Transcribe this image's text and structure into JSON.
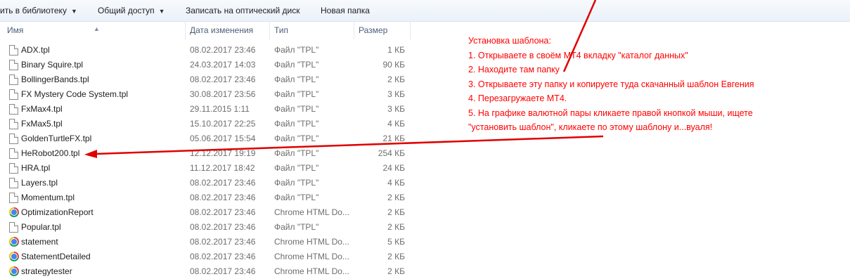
{
  "toolbar": {
    "items": [
      {
        "label": "ить в библиотеку",
        "has_dropdown": true
      },
      {
        "label": "Общий доступ",
        "has_dropdown": true
      },
      {
        "label": "Записать на оптический диск",
        "has_dropdown": false
      },
      {
        "label": "Новая папка",
        "has_dropdown": false
      }
    ]
  },
  "columns": {
    "name": "Имя",
    "date": "Дата изменения",
    "type": "Тип",
    "size": "Размер"
  },
  "files": [
    {
      "name": "ADX.tpl",
      "date": "08.02.2017 23:46",
      "type": "Файл \"TPL\"",
      "size": "1 КБ",
      "icon": "file-icon"
    },
    {
      "name": "Binary Squire.tpl",
      "date": "24.03.2017 14:03",
      "type": "Файл \"TPL\"",
      "size": "90 КБ",
      "icon": "file-icon"
    },
    {
      "name": "BollingerBands.tpl",
      "date": "08.02.2017 23:46",
      "type": "Файл \"TPL\"",
      "size": "2 КБ",
      "icon": "file-icon"
    },
    {
      "name": "FX Mystery Code System.tpl",
      "date": "30.08.2017 23:56",
      "type": "Файл \"TPL\"",
      "size": "3 КБ",
      "icon": "file-icon"
    },
    {
      "name": "FxMax4.tpl",
      "date": "29.11.2015 1:11",
      "type": "Файл \"TPL\"",
      "size": "3 КБ",
      "icon": "file-icon"
    },
    {
      "name": "FxMax5.tpl",
      "date": "15.10.2017 22:25",
      "type": "Файл \"TPL\"",
      "size": "4 КБ",
      "icon": "file-icon"
    },
    {
      "name": "GoldenTurtleFX.tpl",
      "date": "05.06.2017 15:54",
      "type": "Файл \"TPL\"",
      "size": "21 КБ",
      "icon": "file-icon"
    },
    {
      "name": "HeRobot200.tpl",
      "date": "12.12.2017 19:19",
      "type": "Файл \"TPL\"",
      "size": "254 КБ",
      "icon": "file-icon"
    },
    {
      "name": "HRA.tpl",
      "date": "11.12.2017 18:42",
      "type": "Файл \"TPL\"",
      "size": "24 КБ",
      "icon": "file-icon"
    },
    {
      "name": "Layers.tpl",
      "date": "08.02.2017 23:46",
      "type": "Файл \"TPL\"",
      "size": "4 КБ",
      "icon": "file-icon"
    },
    {
      "name": "Momentum.tpl",
      "date": "08.02.2017 23:46",
      "type": "Файл \"TPL\"",
      "size": "2 КБ",
      "icon": "file-icon"
    },
    {
      "name": "OptimizationReport",
      "date": "08.02.2017 23:46",
      "type": "Chrome HTML Do...",
      "size": "2 КБ",
      "icon": "chrome-icon"
    },
    {
      "name": "Popular.tpl",
      "date": "08.02.2017 23:46",
      "type": "Файл \"TPL\"",
      "size": "2 КБ",
      "icon": "file-icon"
    },
    {
      "name": "statement",
      "date": "08.02.2017 23:46",
      "type": "Chrome HTML Do...",
      "size": "5 КБ",
      "icon": "chrome-icon"
    },
    {
      "name": "StatementDetailed",
      "date": "08.02.2017 23:46",
      "type": "Chrome HTML Do...",
      "size": "2 КБ",
      "icon": "chrome-icon"
    },
    {
      "name": "strategytester",
      "date": "08.02.2017 23:46",
      "type": "Chrome HTML Do...",
      "size": "2 КБ",
      "icon": "chrome-icon"
    }
  ],
  "annotation": {
    "color": "#ff0000",
    "lines": [
      "Установка шаблона:",
      "1. Открываете в своём МТ4 вкладку \"каталог данных\"",
      "2. Находите там папку",
      "3. Открываете эту папку и копируете туда скачанный шаблон Евгения",
      "4. Перезагружаете МТ4.",
      "5. На графике валютной пары кликаете правой кнопкой мыши, ищете",
      "\"установить шаблон\", кликаете по этому шаблону и...вуаля!"
    ]
  }
}
